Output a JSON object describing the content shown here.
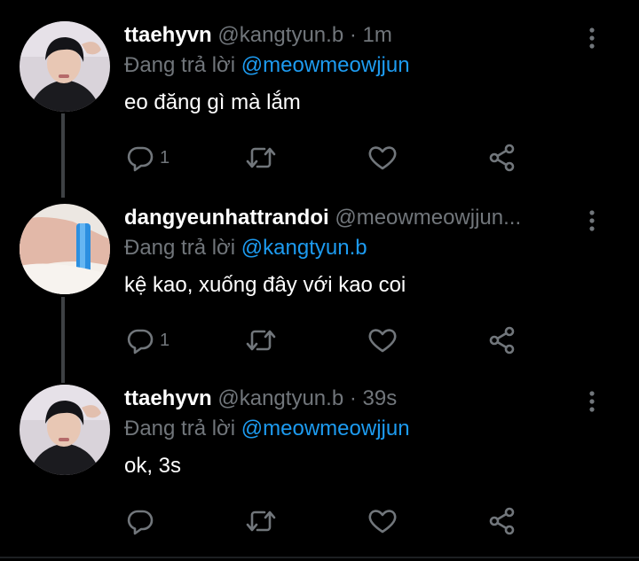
{
  "tweets": [
    {
      "name": "ttaehyvn",
      "handle": "@kangtyun.b",
      "separator": "·",
      "time": "1m",
      "reply_prefix": "Đang trả lời",
      "reply_to": "@meowmeowjjun",
      "text": "eo đăng gì mà lắm",
      "reply_count": "1",
      "avatar_icon": "profile-photo"
    },
    {
      "name": "dangyeunhattrandoi",
      "handle": "@meowmeowjjun...",
      "separator": "",
      "time": "",
      "reply_prefix": "Đang trả lời",
      "reply_to": "@kangtyun.b",
      "text": "kệ kao, xuống đây với kao coi",
      "reply_count": "1",
      "avatar_icon": "profile-photo"
    },
    {
      "name": "ttaehyvn",
      "handle": "@kangtyun.b",
      "separator": "·",
      "time": "39s",
      "reply_prefix": "Đang trả lời",
      "reply_to": "@meowmeowjjun",
      "text": "ok, 3s",
      "reply_count": "",
      "avatar_icon": "profile-photo"
    }
  ],
  "colors": {
    "background": "#000000",
    "name": "#ffffff",
    "muted": "#71767b",
    "link": "#1d9bf0",
    "thread_line": "#3e4144"
  },
  "icons": [
    "more-vertical-icon",
    "reply-icon",
    "retweet-icon",
    "like-icon",
    "share-icon"
  ]
}
